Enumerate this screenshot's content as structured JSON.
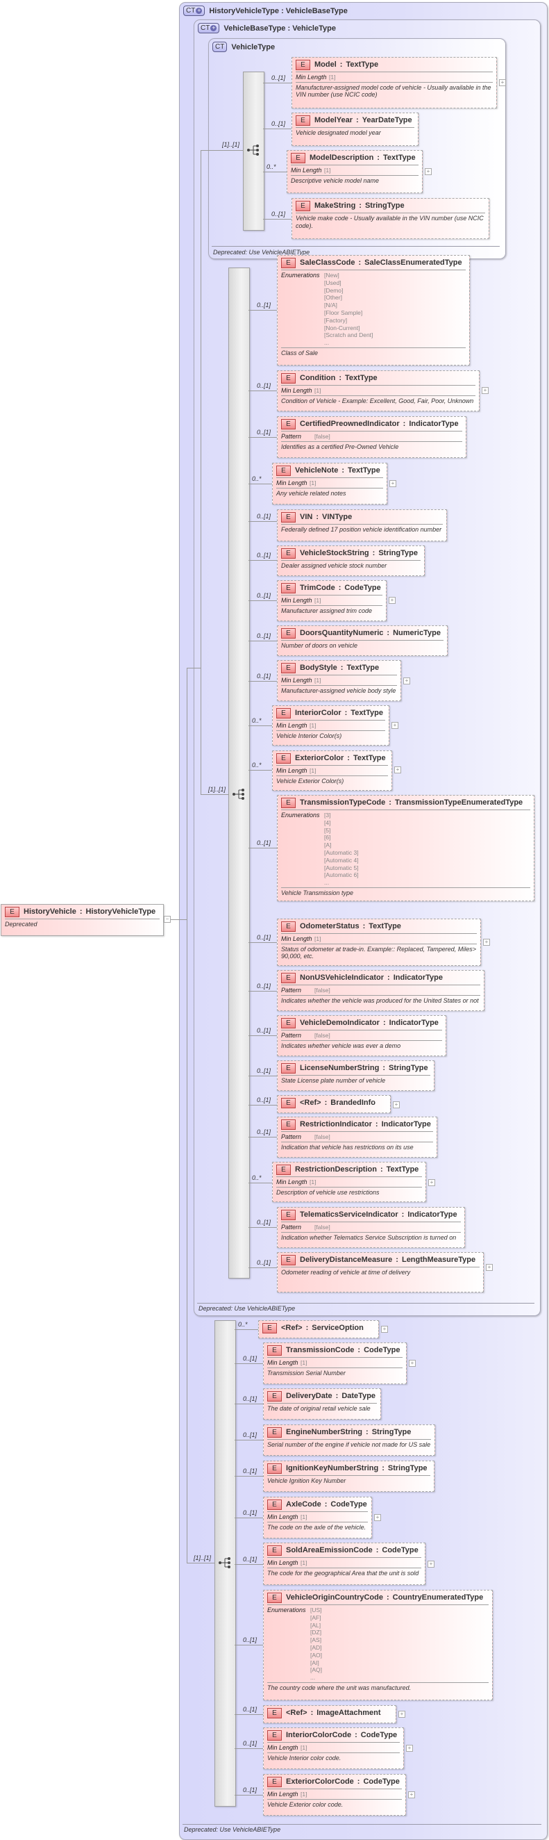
{
  "root_element": {
    "badge": "E",
    "name": "HistoryVehicle",
    "separator": ":",
    "type": "HistoryVehicleType",
    "description": "Deprecated",
    "collapse_symbol": "−"
  },
  "history_vehicle_type": {
    "badge": "CT",
    "title": "HistoryVehicleType : VehicleBaseType",
    "deprecated": "Deprecated: Use VehicleABIEType",
    "sequence_cardinality": "[1]..[1]",
    "elements": [
      {
        "name": "<Ref>",
        "type": "ServiceOption",
        "cardinality": "0..*",
        "expandable": true
      },
      {
        "name": "TransmissionCode",
        "type": "CodeType",
        "cardinality": "0..[1]",
        "facet_label": "Min Length",
        "facet_values": [
          "[1]"
        ],
        "description": "Transmission Serial Number",
        "expandable": true
      },
      {
        "name": "DeliveryDate",
        "type": "DateType",
        "cardinality": "0..[1]",
        "description": "The date of original retail vehicle sale"
      },
      {
        "name": "EngineNumberString",
        "type": "StringType",
        "cardinality": "0..[1]",
        "description": "Serial number of the engine if vehicle not made for US sale"
      },
      {
        "name": "IgnitionKeyNumberString",
        "type": "StringType",
        "cardinality": "0..[1]",
        "description": "Vehicle Ignition Key Number"
      },
      {
        "name": "AxleCode",
        "type": "CodeType",
        "cardinality": "0..[1]",
        "facet_label": "Min Length",
        "facet_values": [
          "[1]"
        ],
        "description": "The code on the axle of the vehicle.",
        "expandable": true
      },
      {
        "name": "SoldAreaEmissionCode",
        "type": "CodeType",
        "cardinality": "0..[1]",
        "facet_label": "Min Length",
        "facet_values": [
          "[1]"
        ],
        "description": "The code for the geographical Area that the unit is sold",
        "expandable": true
      },
      {
        "name": "VehicleOriginCountryCode",
        "type": "CountryEnumeratedType",
        "cardinality": "0..[1]",
        "facet_label": "Enumerations",
        "facet_values": [
          "[US]",
          "[AF]",
          "[AL]",
          "[DZ]",
          "[AS]",
          "[AD]",
          "[AO]",
          "[AI]",
          "[AQ]",
          "..."
        ],
        "description": "The country code where the unit was manufactured."
      },
      {
        "name": "<Ref>",
        "type": "ImageAttachment",
        "cardinality": "0..[1]",
        "expandable": true
      },
      {
        "name": "InteriorColorCode",
        "type": "CodeType",
        "cardinality": "0..[1]",
        "facet_label": "Min Length",
        "facet_values": [
          "[1]"
        ],
        "description": "Vehicle Interior color code.",
        "expandable": true
      },
      {
        "name": "ExteriorColorCode",
        "type": "CodeType",
        "cardinality": "0..[1]",
        "facet_label": "Min Length",
        "facet_values": [
          "[1]"
        ],
        "description": "Vehicle Exterior color code.",
        "expandable": true
      }
    ]
  },
  "vehicle_base_type": {
    "badge": "CT",
    "title": "VehicleBaseType : VehicleType",
    "deprecated": "Deprecated: Use VehicleABIEType",
    "sequence_cardinality": "[1]..[1]",
    "elements": [
      {
        "name": "SaleClassCode",
        "type": "SaleClassEnumeratedType",
        "cardinality": "0..[1]",
        "facet_label": "Enumerations",
        "facet_values": [
          "[New]",
          "[Used]",
          "[Demo]",
          "[Other]",
          "[N/A]",
          "[Floor Sample]",
          "[Factory]",
          "[Non-Current]",
          "[Scratch and Dent]",
          "..."
        ],
        "description": "Class of Sale"
      },
      {
        "name": "Condition",
        "type": "TextType",
        "cardinality": "0..[1]",
        "facet_label": "Min Length",
        "facet_values": [
          "[1]"
        ],
        "description": "Condition of Vehicle - Example: Excellent, Good, Fair, Poor, Unknown",
        "expandable": true
      },
      {
        "name": "CertifiedPreownedIndicator",
        "type": "IndicatorType",
        "cardinality": "0..[1]",
        "facet_label": "Pattern",
        "facet_values": [
          "[false]"
        ],
        "description": "Identifies as a certified Pre-Owned Vehicle"
      },
      {
        "name": "VehicleNote",
        "type": "TextType",
        "cardinality": "0..*",
        "facet_label": "Min Length",
        "facet_values": [
          "[1]"
        ],
        "description": "Any vehicle related notes",
        "expandable": true
      },
      {
        "name": "VIN",
        "type": "VINType",
        "cardinality": "0..[1]",
        "description": "Federally defined 17 position vehicle identification number"
      },
      {
        "name": "VehicleStockString",
        "type": "StringType",
        "cardinality": "0..[1]",
        "description": "Dealer assigned vehicle stock number"
      },
      {
        "name": "TrimCode",
        "type": "CodeType",
        "cardinality": "0..[1]",
        "facet_label": "Min Length",
        "facet_values": [
          "[1]"
        ],
        "description": "Manufacturer assigned trim code",
        "expandable": true
      },
      {
        "name": "DoorsQuantityNumeric",
        "type": "NumericType",
        "cardinality": "0..[1]",
        "description": "Number of doors on vehicle"
      },
      {
        "name": "BodyStyle",
        "type": "TextType",
        "cardinality": "0..[1]",
        "facet_label": "Min Length",
        "facet_values": [
          "[1]"
        ],
        "description": "Manufacturer-assigned vehicle body style",
        "expandable": true
      },
      {
        "name": "InteriorColor",
        "type": "TextType",
        "cardinality": "0..*",
        "facet_label": "Min Length",
        "facet_values": [
          "[1]"
        ],
        "description": "Vehicle Interior Color(s)",
        "expandable": true
      },
      {
        "name": "ExteriorColor",
        "type": "TextType",
        "cardinality": "0..*",
        "facet_label": "Min Length",
        "facet_values": [
          "[1]"
        ],
        "description": "Vehicle Exterior Color(s)",
        "expandable": true
      },
      {
        "name": "TransmissionTypeCode",
        "type": "TransmissionTypeEnumeratedType",
        "cardinality": "0..[1]",
        "facet_label": "Enumerations",
        "facet_values": [
          "[3]",
          "[4]",
          "[5]",
          "[6]",
          "[A]",
          "[Automatic 3]",
          "[Automatic 4]",
          "[Automatic 5]",
          "[Automatic 6]",
          "..."
        ],
        "description": "Vehicle Transmission type"
      },
      {
        "name": "OdometerStatus",
        "type": "TextType",
        "cardinality": "0..[1]",
        "facet_label": "Min Length",
        "facet_values": [
          "[1]"
        ],
        "description": "Status of odometer at trade-in. Example:: Replaced, Tampered, Miles> 90,000, etc.",
        "expandable": true
      },
      {
        "name": "NonUSVehicleIndicator",
        "type": "IndicatorType",
        "cardinality": "0..[1]",
        "facet_label": "Pattern",
        "facet_values": [
          "[false]"
        ],
        "description": "Indicates whether the vehicle was produced for the United States or not"
      },
      {
        "name": "VehicleDemoIndicator",
        "type": "IndicatorType",
        "cardinality": "0..[1]",
        "facet_label": "Pattern",
        "facet_values": [
          "[false]"
        ],
        "description": "Indicates whether vehicle was ever a demo"
      },
      {
        "name": "LicenseNumberString",
        "type": "StringType",
        "cardinality": "0..[1]",
        "description": "State License plate number of vehicle"
      },
      {
        "name": "<Ref>",
        "type": "BrandedInfo",
        "cardinality": "0..[1]",
        "expandable": true
      },
      {
        "name": "RestrictionIndicator",
        "type": "IndicatorType",
        "cardinality": "0..[1]",
        "facet_label": "Pattern",
        "facet_values": [
          "[false]"
        ],
        "description": "Indication that vehicle has restrictions on its use"
      },
      {
        "name": "RestrictionDescription",
        "type": "TextType",
        "cardinality": "0..*",
        "facet_label": "Min Length",
        "facet_values": [
          "[1]"
        ],
        "description": "Description of vehicle use restrictions",
        "expandable": true
      },
      {
        "name": "TelematicsServiceIndicator",
        "type": "IndicatorType",
        "cardinality": "0..[1]",
        "facet_label": "Pattern",
        "facet_values": [
          "[false]"
        ],
        "description": "Indication whether Telematics Service Subscription is turned on"
      },
      {
        "name": "DeliveryDistanceMeasure",
        "type": "LengthMeasureType",
        "cardinality": "0..[1]",
        "description": "Odometer reading of vehicle at time of delivery",
        "expandable": true
      }
    ]
  },
  "vehicle_type": {
    "badge": "CT",
    "title": "VehicleType",
    "deprecated": "Deprecated: Use VehicleABIEType",
    "sequence_cardinality": "[1]..[1]",
    "elements": [
      {
        "name": "Model",
        "type": "TextType",
        "cardinality": "0..[1]",
        "facet_label": "Min Length",
        "facet_values": [
          "[1]"
        ],
        "description": "Manufacturer-assigned model code of vehicle - Usually available in the VIN number (use NCIC code)",
        "expandable": true
      },
      {
        "name": "ModelYear",
        "type": "YearDateType",
        "cardinality": "0..[1]",
        "description": "Vehicle designated model year"
      },
      {
        "name": "ModelDescription",
        "type": "TextType",
        "cardinality": "0..*",
        "facet_label": "Min Length",
        "facet_values": [
          "[1]"
        ],
        "description": "Descriptive vehicle model name",
        "expandable": true
      },
      {
        "name": "MakeString",
        "type": "StringType",
        "cardinality": "0..[1]",
        "description": "Vehicle make code - Usually available in the VIN number (use NCIC code)."
      }
    ]
  },
  "labels": {
    "element_badge": "E",
    "separator": ":",
    "expand_symbol": "+",
    "ct_plus": "+"
  }
}
